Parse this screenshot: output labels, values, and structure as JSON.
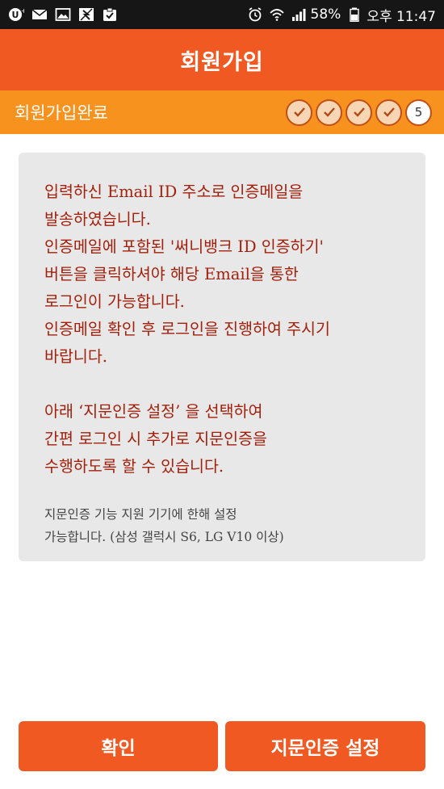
{
  "status_bar": {
    "left_icons": [
      "u-plus-icon",
      "mail-icon",
      "image-icon",
      "disabled-icon",
      "clipboard-check-icon"
    ],
    "right_icons": [
      "alarm-icon",
      "wifi-icon",
      "signal-icon",
      "battery-icon"
    ],
    "battery": "58%",
    "time": "오후 11:47"
  },
  "header": {
    "title": "회원가입"
  },
  "steps": {
    "label": "회원가입완료",
    "completed_count": 4,
    "current": "5"
  },
  "message": {
    "lines_1": [
      "입력하신 Email ID 주소로 인증메일을",
      "발송하였습니다.",
      "인증메일에 포함된 '써니뱅크 ID 인증하기'",
      "버튼을 클릭하셔야 해당 Email을 통한",
      "로그인이 가능합니다.",
      "인증메일 확인 후 로그인을 진행하여 주시기",
      "바랍니다."
    ],
    "lines_2": [
      "아래 ‘지문인증 설정’ 을 선택하여",
      "간편 로그인 시 추가로 지문인증을",
      "수행하도록 할 수 있습니다."
    ],
    "note_lines": [
      "지문인증 기능 지원 기기에 한해 설정",
      "가능합니다. (삼성 갤럭시 S6, LG V10 이상)"
    ]
  },
  "buttons": {
    "confirm": "확인",
    "fingerprint": "지문인증 설정"
  },
  "colors": {
    "header": "#f05a22",
    "step_bar": "#f7921e",
    "message_text": "#a2200c",
    "info_box": "#e8e8e8"
  }
}
